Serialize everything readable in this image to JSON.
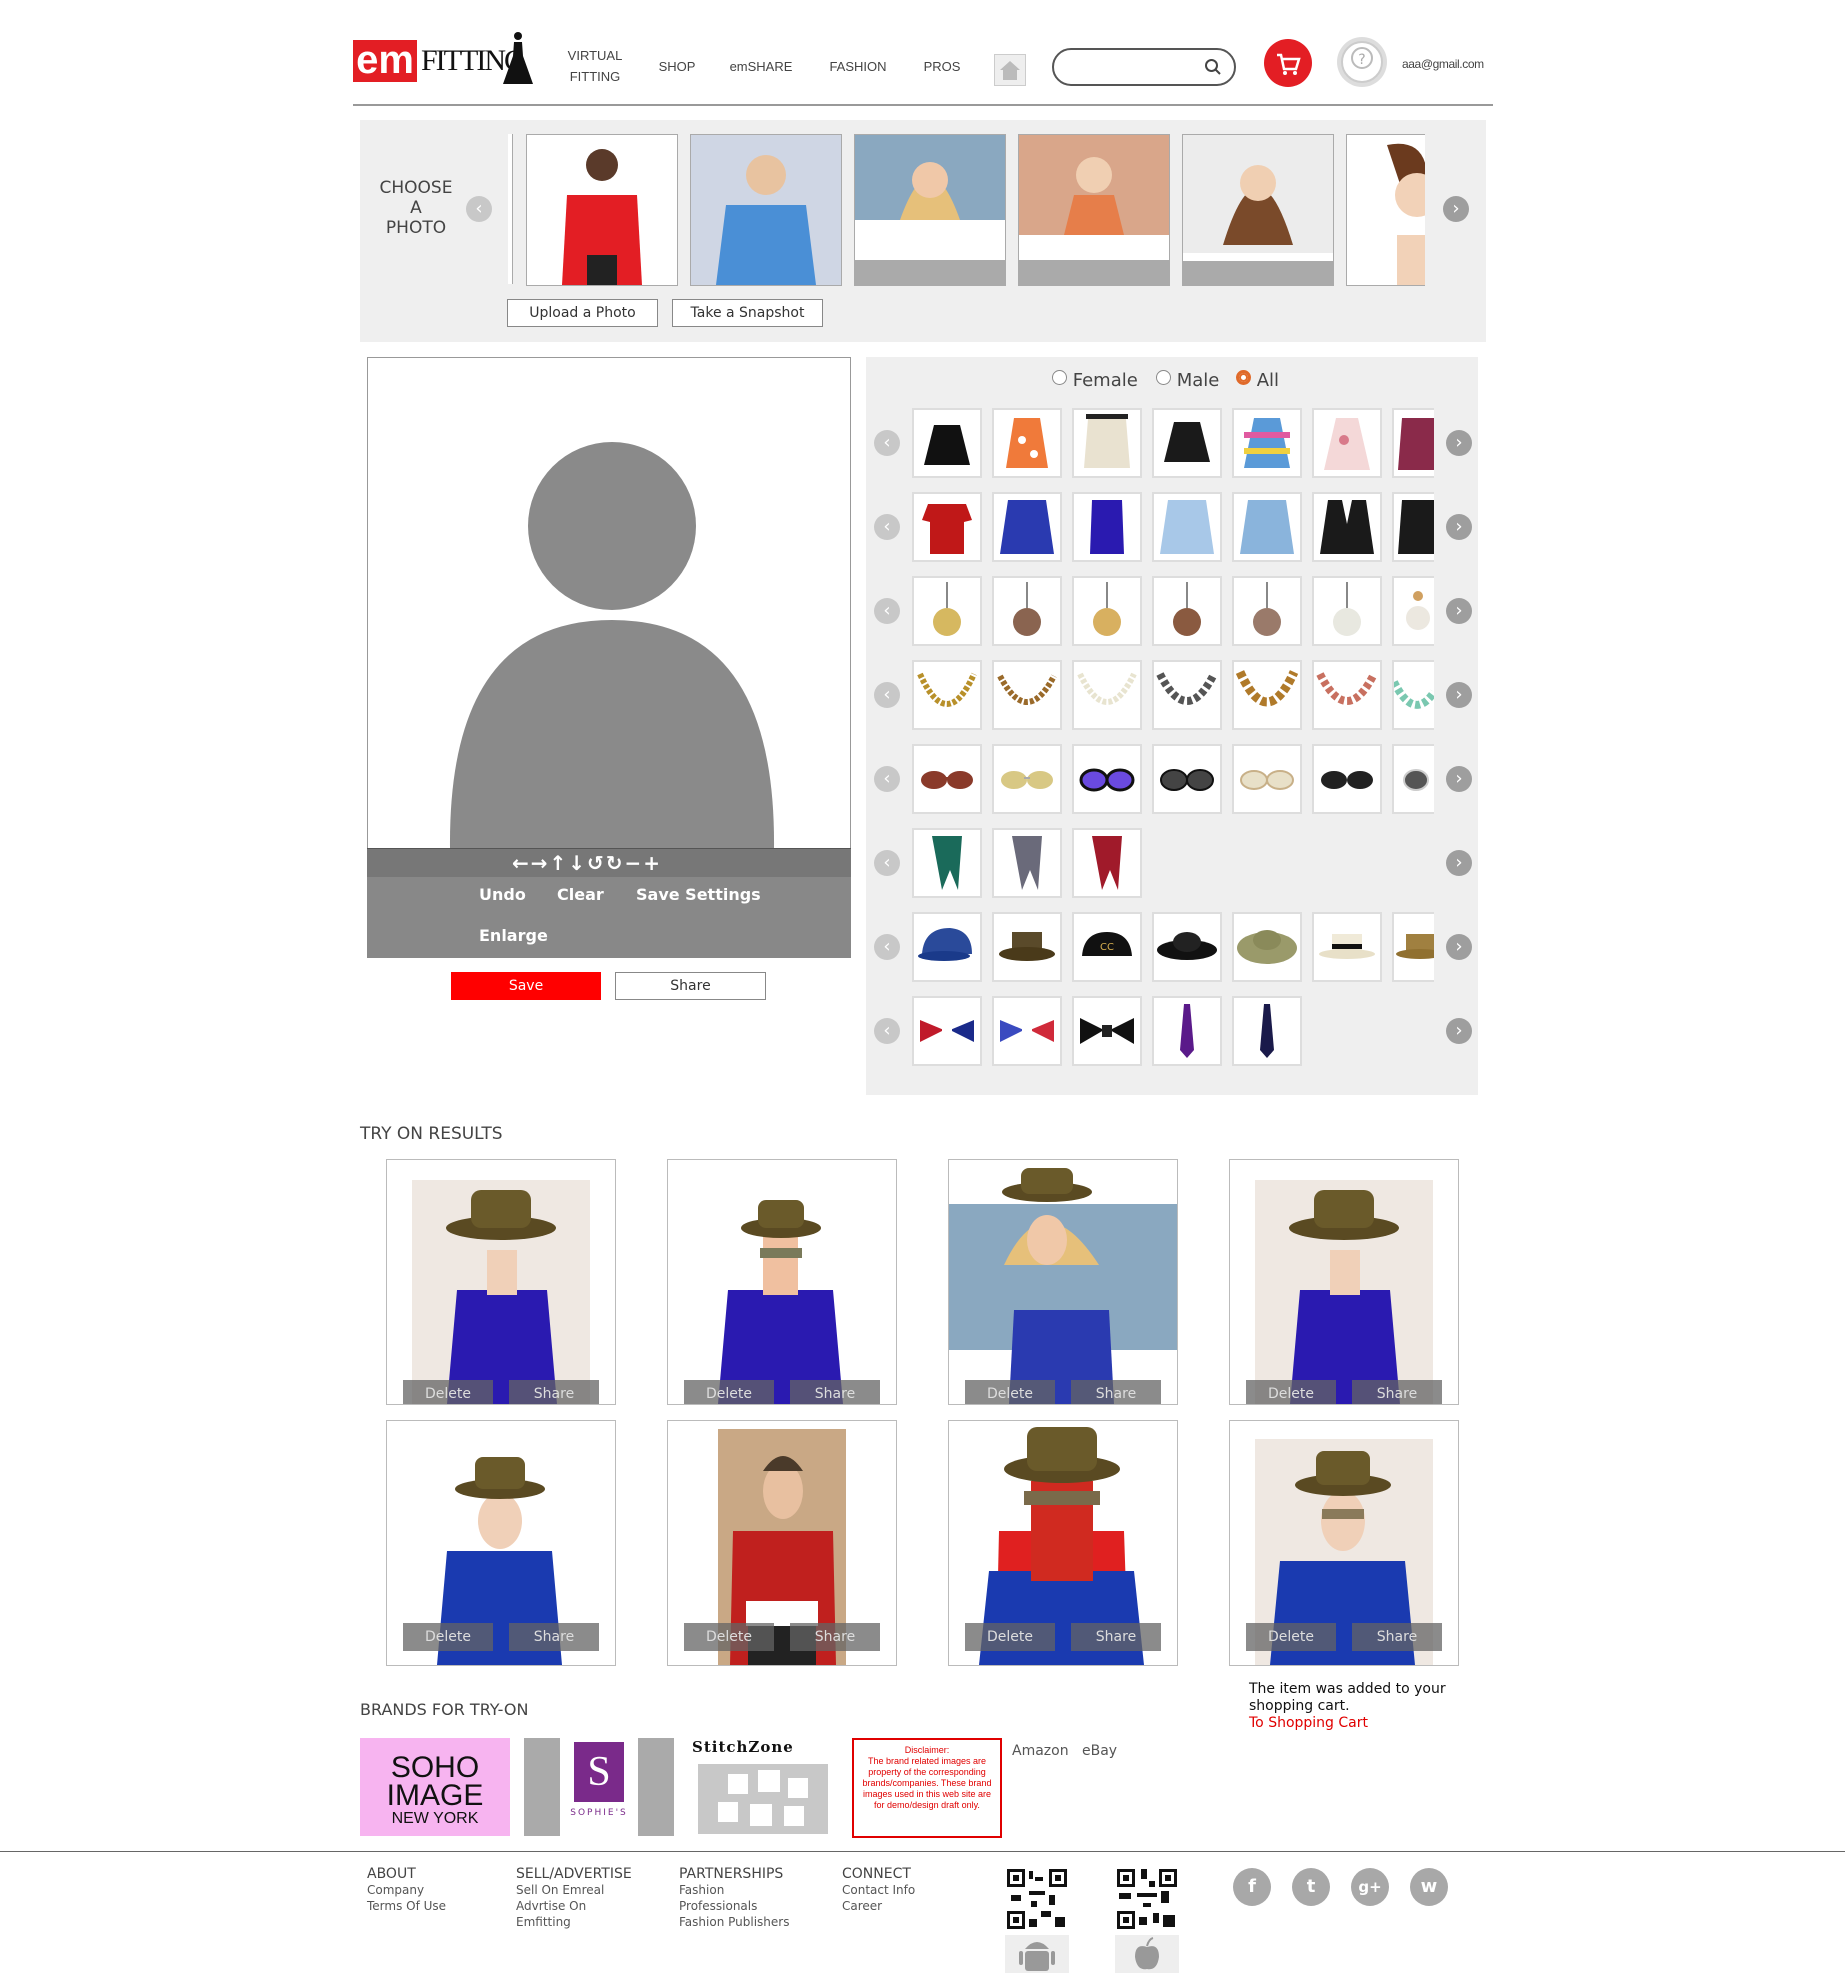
{
  "header": {
    "logo_em": "em",
    "logo_fitting": "FITTING",
    "nav": [
      "VIRTUAL\nFITTING",
      "SHOP",
      "emSHARE",
      "FASHION",
      "PROS"
    ],
    "user_email": "aaa@gmail.com",
    "search_placeholder": ""
  },
  "photo_strip": {
    "choose_label": "CHOOSE\nA\nPHOTO",
    "upload_label": "Upload a Photo",
    "snapshot_label": "Take a Snapshot"
  },
  "editor": {
    "undo": "Undo",
    "clear": "Clear",
    "save_settings": "Save Settings",
    "enlarge": "Enlarge",
    "save": "Save",
    "share": "Share",
    "controls": "←→↑↓↺↻−+"
  },
  "filter": {
    "options": [
      "Female",
      "Male",
      "All"
    ],
    "selected": "All"
  },
  "results": {
    "title": "TRY ON RESULTS",
    "delete_label": "Delete",
    "share_label": "Share"
  },
  "cart_message": {
    "text": "The item was added to your shopping cart.",
    "link": "To Shopping Cart"
  },
  "brands": {
    "title": "BRANDS FOR TRY-ON",
    "soho": [
      "SOHO",
      "IMAGE",
      "NEW YORK"
    ],
    "sophies": "SOPHIE'S",
    "stitchzone": "StitchZone",
    "disclaimer": "Disclaimer:\nThe brand related images are property of the corresponding brands/companies. These brand images used in this web site are for demo/design draft only.",
    "links": [
      "Amazon",
      "eBay"
    ]
  },
  "footer": {
    "columns": [
      {
        "title": "ABOUT",
        "items": [
          "Company",
          "Terms Of Use"
        ]
      },
      {
        "title": "SELL/ADVERTISE",
        "items": [
          "Sell On Emreal",
          "Advrtise On",
          "Emfitting"
        ]
      },
      {
        "title": "PARTNERSHIPS",
        "items": [
          "Fashion",
          "Professionals",
          "Fashion Publishers"
        ]
      },
      {
        "title": "CONNECT",
        "items": [
          "Contact Info",
          "Career"
        ]
      }
    ],
    "social": [
      "f",
      "t",
      "g+",
      "w"
    ]
  },
  "colors": {
    "brand_red": "#e31e24",
    "panel_gray": "#efefef",
    "toolbar_gray": "#888888",
    "link_red": "#e00000"
  }
}
